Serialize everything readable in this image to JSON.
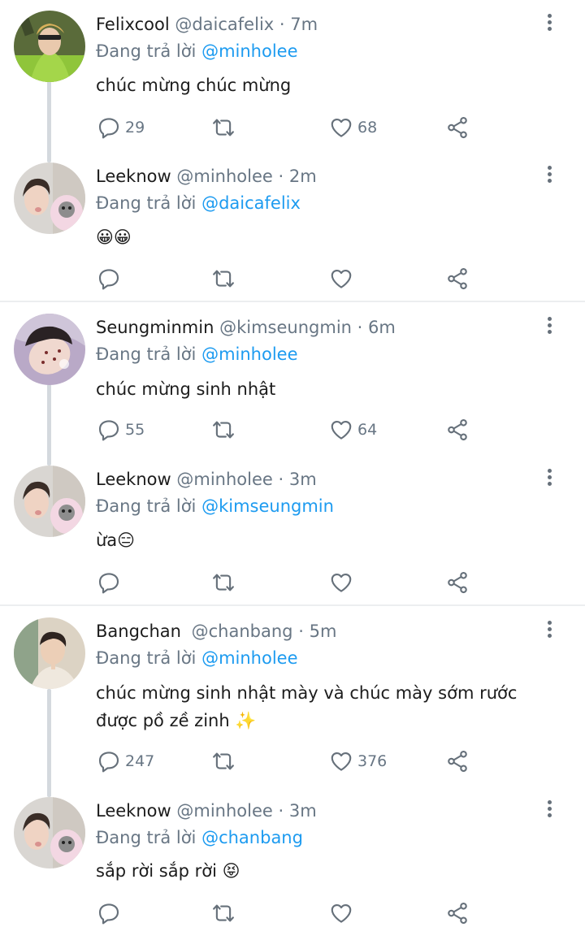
{
  "reply_prefix": "Đang trả lời",
  "colors": {
    "link": "#1d9bf0",
    "muted": "#687684",
    "thread_line": "#d4d9de"
  },
  "tweets": [
    {
      "name": "Felixcool",
      "handle": "@daicafelix",
      "time": "7m",
      "reply_to": "@minholee",
      "text": "chúc mừng chúc mừng",
      "text2": "",
      "replies": "29",
      "retweets": "",
      "likes": "68",
      "avatar": "felix-avatar"
    },
    {
      "name": "Leeknow",
      "handle": "@minholee",
      "time": "2m",
      "reply_to": "@daicafelix",
      "text": "😀😀",
      "text2": "",
      "replies": "",
      "retweets": "",
      "likes": "",
      "avatar": "leeknow-avatar"
    },
    {
      "name": "Seungminmin",
      "handle": "@kimseungmin",
      "time": "6m",
      "reply_to": "@minholee",
      "text": "chúc mừng sinh nhật",
      "text2": "",
      "replies": "55",
      "retweets": "",
      "likes": "64",
      "avatar": "seungmin-avatar"
    },
    {
      "name": "Leeknow",
      "handle": "@minholee",
      "time": "3m",
      "reply_to": "@kimseungmin",
      "text": "ừa😑",
      "text2": "",
      "replies": "",
      "retweets": "",
      "likes": "",
      "avatar": "leeknow-avatar"
    },
    {
      "name": "Bangchan",
      "handle": "@chanbang",
      "time": "5m",
      "reply_to": "@minholee",
      "text": "chúc mừng sinh nhật mày và chúc mày sớm rước",
      "text2": "được pồ zề zinh ✨",
      "replies": "247",
      "retweets": "",
      "likes": "376",
      "avatar": "bangchan-avatar"
    },
    {
      "name": "Leeknow",
      "handle": "@minholee",
      "time": "3m",
      "reply_to": "@chanbang",
      "text": "sắp rời sắp rời 😝",
      "text2": "",
      "replies": "",
      "retweets": "",
      "likes": "",
      "avatar": "leeknow-avatar"
    }
  ]
}
